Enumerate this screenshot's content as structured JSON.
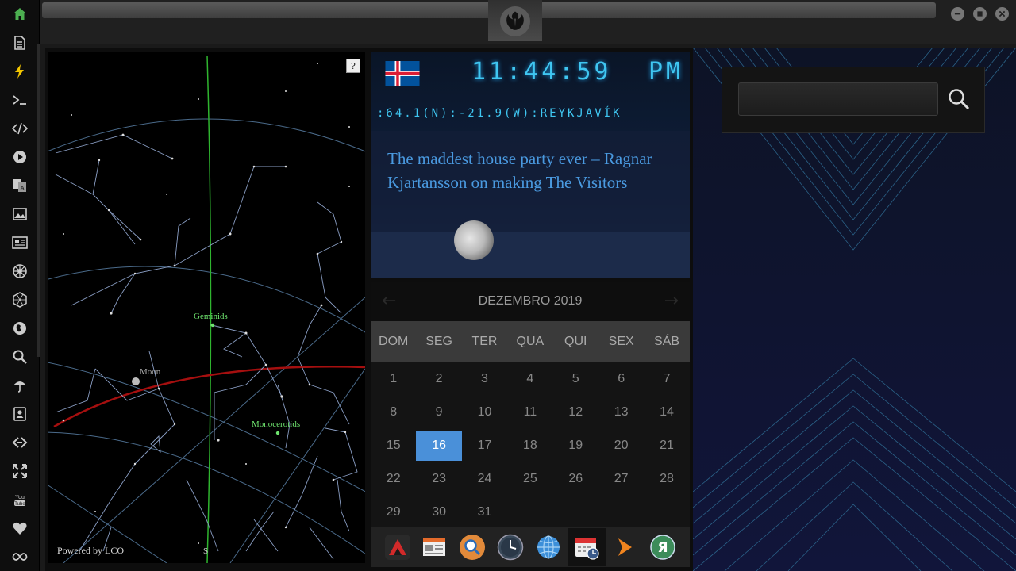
{
  "sidebar": {
    "items": [
      {
        "name": "home-icon"
      },
      {
        "name": "document-icon"
      },
      {
        "name": "bolt-icon"
      },
      {
        "name": "terminal-icon"
      },
      {
        "name": "code-icon"
      },
      {
        "name": "play-icon"
      },
      {
        "name": "translate-icon"
      },
      {
        "name": "image-icon"
      },
      {
        "name": "news-icon"
      },
      {
        "name": "empire-icon"
      },
      {
        "name": "hexagon-icon"
      },
      {
        "name": "globe-icon"
      },
      {
        "name": "search-icon"
      },
      {
        "name": "umbrella-icon"
      },
      {
        "name": "contact-icon"
      },
      {
        "name": "link-icon"
      },
      {
        "name": "expand-icon"
      },
      {
        "name": "youtube-icon"
      },
      {
        "name": "heart-icon"
      },
      {
        "name": "infinity-icon"
      }
    ],
    "accent": "#4caf50"
  },
  "skymap": {
    "help": "?",
    "powered_by": "Powered by LCO",
    "labels": {
      "geminids": "Geminids",
      "moon": "Moon",
      "monocerotids": "Monocerotids",
      "south": "S"
    }
  },
  "clock": {
    "time": "11:44:59",
    "ampm": "PM",
    "location": ":64.1(N):-21.9(W):REYKJAVÍK"
  },
  "news": {
    "title": "The maddest house party ever – Ragnar Kjartansson on making The Visitors"
  },
  "calendar": {
    "prev": "←",
    "next": "→",
    "month": "DEZEMBRO 2019",
    "daynames": [
      "DOM",
      "SEG",
      "TER",
      "QUA",
      "QUI",
      "SEX",
      "SÁB"
    ],
    "weeks": [
      [
        "1",
        "2",
        "3",
        "4",
        "5",
        "6",
        "7"
      ],
      [
        "8",
        "9",
        "10",
        "11",
        "12",
        "13",
        "14"
      ],
      [
        "15",
        "16",
        "17",
        "18",
        "19",
        "20",
        "21"
      ],
      [
        "22",
        "23",
        "24",
        "25",
        "26",
        "27",
        "28"
      ],
      [
        "29",
        "30",
        "31",
        "",
        "",
        "",
        ""
      ]
    ],
    "today": "16",
    "today_color": "#4a90d9"
  },
  "dock": {
    "items": [
      {
        "name": "mountain-app-icon"
      },
      {
        "name": "news-app-icon"
      },
      {
        "name": "search-app-icon"
      },
      {
        "name": "clock-app-icon"
      },
      {
        "name": "globe-app-icon"
      },
      {
        "name": "calendar-app-icon"
      },
      {
        "name": "arrow-app-icon"
      },
      {
        "name": "yandex-app-icon"
      }
    ]
  },
  "search": {
    "placeholder": ""
  }
}
